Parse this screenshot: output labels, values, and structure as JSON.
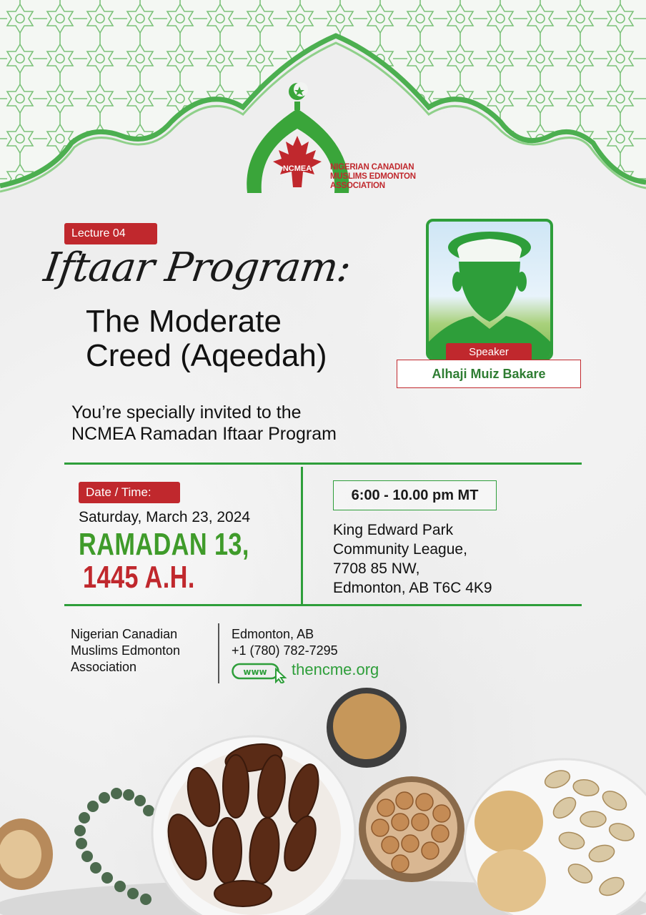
{
  "logo": {
    "abbr": "NCMEA",
    "name": "NIGERIAN CANADIAN MUSLIMS EDMONTON ASSOCIATION",
    "icon": "mosque-dome-maple-leaf-icon"
  },
  "lecture_label": "Lecture 04",
  "script_title": "Iftaar Program:",
  "title_line1": "The Moderate",
  "title_line2": "Creed (Aqeedah)",
  "speaker": {
    "badge": "Speaker",
    "name": "Alhaji Muiz Bakare",
    "icon": "speaker-silhouette-icon"
  },
  "invite_line1": "You’re specially invited to the",
  "invite_line2": "NCMEA Ramadan Iftaar Program",
  "date_badge": "Date / Time:",
  "date": "Saturday, March 23, 2024",
  "ramadan_line1": "RAMADAN 13,",
  "ramadan_line2": "1445 A.H.",
  "time": "6:00 - 10.00 pm MT",
  "venue": {
    "line1": "King Edward Park",
    "line2": "Community League,",
    "line3": "7708 85 NW,",
    "line4": "Edmonton, AB T6C 4K9"
  },
  "org": {
    "line1": "Nigerian Canadian",
    "line2": "Muslims Edmonton",
    "line3": "Association"
  },
  "contact": {
    "city": "Edmonton, AB",
    "phone": "+1 (780) 782-7295",
    "web_icon_text": "www",
    "website": "thencme.org"
  },
  "colors": {
    "green": "#2e9e3a",
    "red": "#c0282d",
    "background": "#eeeeee"
  }
}
